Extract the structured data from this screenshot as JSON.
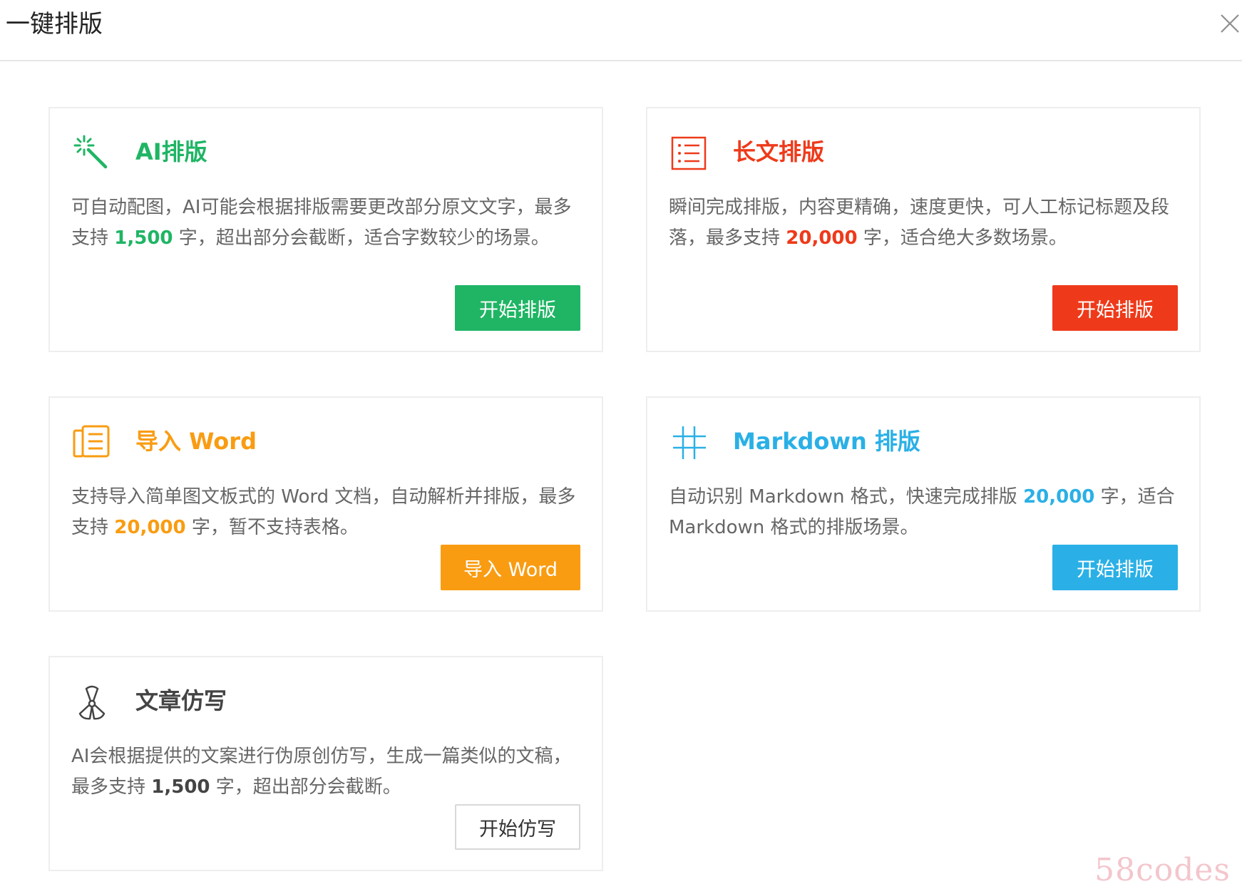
{
  "dialog": {
    "title": "一键排版"
  },
  "cards": {
    "ai": {
      "title": "AI排版",
      "desc_before": "可自动配图，AI可能会根据排版需要更改部分原文文字，最多支持 ",
      "limit": "1,500",
      "desc_after": " 字，超出部分会截断，适合字数较少的场景。",
      "button": "开始排版",
      "accent": "#1fb564",
      "icon": "magic-wand-icon"
    },
    "long": {
      "title": "长文排版",
      "desc_before": "瞬间完成排版，内容更精确，速度更快，可人工标记标题及段落，最多支持 ",
      "limit": "20,000",
      "desc_after": " 字，适合绝大多数场景。",
      "button": "开始排版",
      "accent": "#ee3a1a",
      "icon": "list-icon"
    },
    "word": {
      "title": "导入 Word",
      "desc_before": "支持导入简单图文板式的 Word 文档，自动解析并排版，最多支持 ",
      "limit": "20,000",
      "desc_after": " 字，暂不支持表格。",
      "button": "导入 Word",
      "accent": "#f99c12",
      "icon": "document-icon"
    },
    "markdown": {
      "title": "Markdown 排版",
      "desc_before": "自动识别 Markdown 格式，快速完成排版 ",
      "limit": "20,000",
      "desc_after": " 字，适合 Markdown 格式的排版场景。",
      "button": "开始排版",
      "accent": "#2ab0e6",
      "icon": "hash-icon"
    },
    "rewrite": {
      "title": "文章仿写",
      "desc_before": "AI会根据提供的文案进行伪原创仿写，生成一篇类似的文稿，最多支持 ",
      "limit": "1,500",
      "desc_after": " 字，超出部分会截断。",
      "button": "开始仿写",
      "accent": "#444444",
      "icon": "propeller-icon"
    }
  },
  "watermark": {
    "text": "58codes"
  }
}
